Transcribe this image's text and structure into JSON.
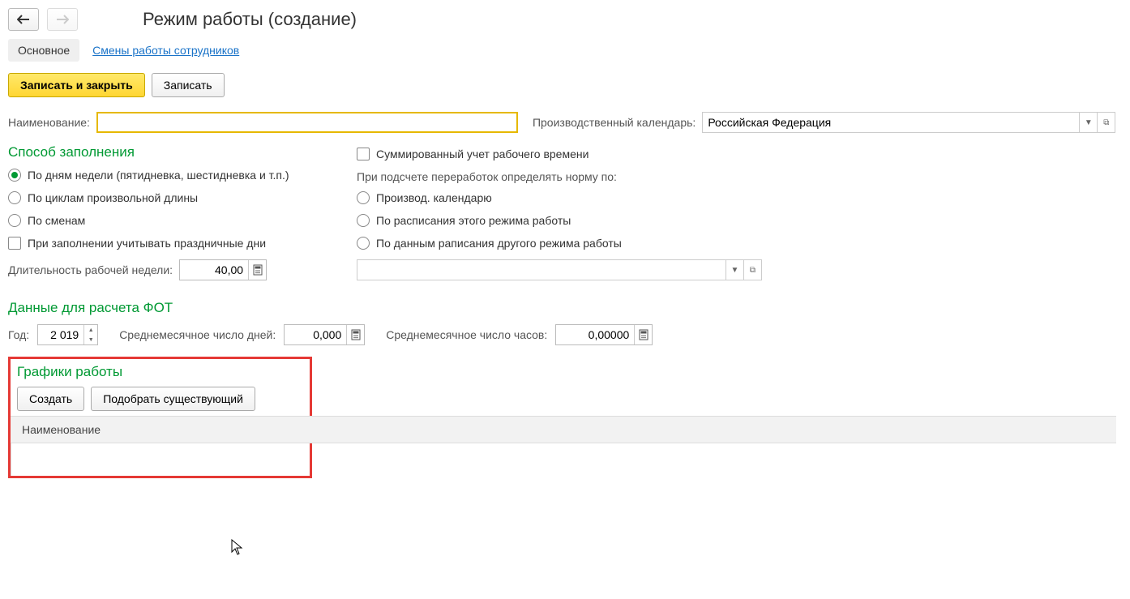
{
  "header": {
    "title": "Режим работы (создание)"
  },
  "tabs": {
    "main": "Основное",
    "shifts": "Смены работы сотрудников"
  },
  "toolbar": {
    "save_close": "Записать и закрыть",
    "save": "Записать"
  },
  "fields": {
    "name_label": "Наименование:",
    "name_value": "",
    "calendar_label": "Производственный календарь:",
    "calendar_value": "Российская Федерация"
  },
  "fill_method": {
    "title": "Способ заполнения",
    "by_weekdays": "По дням недели (пятидневка, шестидневка и т.п.)",
    "by_cycles": "По циклам произвольной длины",
    "by_shifts": "По сменам",
    "holidays_check": "При заполнении учитывать праздничные дни",
    "week_duration_label": "Длительность рабочей недели:",
    "week_duration_value": "40,00"
  },
  "summarized": {
    "checkbox": "Суммированный учет рабочего времени",
    "norm_label": "При подсчете переработок определять норму по:",
    "by_prod_cal": "Производ. календарю",
    "by_this_sched": "По расписания этого режима работы",
    "by_other_sched": "По данным раписания другого режима работы"
  },
  "fot": {
    "title": "Данные для расчета ФОТ",
    "year_label": "Год:",
    "year_value": "2 019",
    "avg_days_label": "Среднемесячное число дней:",
    "avg_days_value": "0,000",
    "avg_hours_label": "Среднемесячное число часов:",
    "avg_hours_value": "0,00000"
  },
  "schedules": {
    "title": "Графики работы",
    "create": "Создать",
    "pick": "Подобрать существующий",
    "column_name": "Наименование"
  }
}
